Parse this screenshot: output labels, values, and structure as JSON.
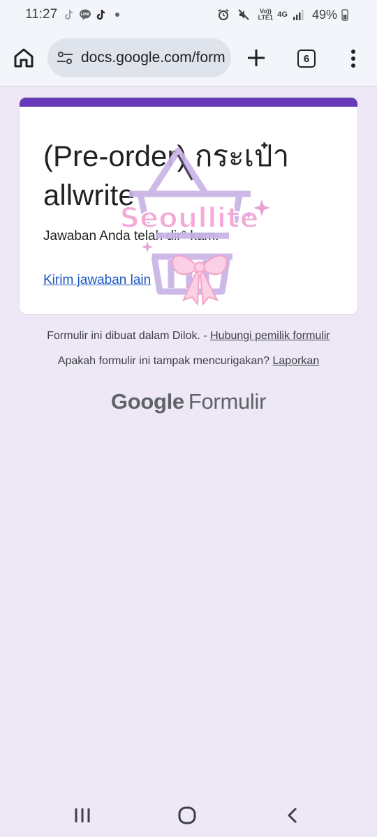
{
  "status_bar": {
    "time": "11:27",
    "notification_icons": [
      "tiktok-lite-icon",
      "line-icon",
      "tiktok-icon",
      "more-dot-icon"
    ],
    "system_icons": [
      "alarm-icon",
      "mute-icon",
      "volte-icon",
      "4g-icon",
      "signal-icon"
    ],
    "volte_label": "Vo)) LTE1",
    "network_label": "4G",
    "battery": "49%"
  },
  "toolbar": {
    "url": "docs.google.com/form",
    "tab_count": "6"
  },
  "card": {
    "accent_color": "#673ab7",
    "title": "(Pre-order) กระเป๋า allwrite",
    "confirmation": "Jawaban Anda telah dir° kam.",
    "resubmit_link": "Kirim jawaban lain",
    "watermark_text": "Seoullite"
  },
  "footer": {
    "made_in_text": "Formulir ini dibuat dalam Dilok. -",
    "contact_link": "Hubungi pemilik formulir",
    "suspicious_text": "Apakah formulir ini tampak mencurigakan?",
    "report_link": "Laporkan",
    "brand_google": "Google",
    "brand_product": "Formulir"
  },
  "nav_bar": {
    "buttons": [
      "recents-icon",
      "home-icon",
      "back-icon"
    ]
  }
}
